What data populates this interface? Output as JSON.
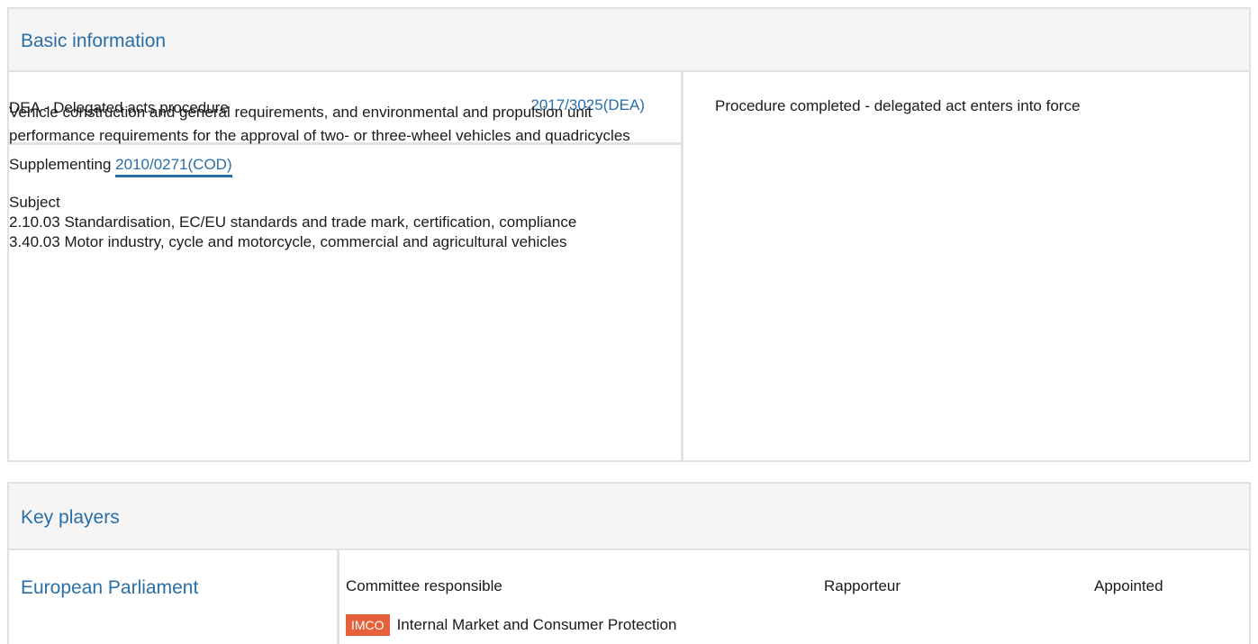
{
  "basic_info": {
    "title": "Basic information",
    "procedure_type": "DEA - Delegated acts procedure",
    "procedure_ref": "2017/3025(DEA)",
    "status": "Procedure completed - delegated act enters into force",
    "description": "Vehicle construction and general requirements, and environmental and propulsion unit performance requirements for the approval of two- or three-wheel vehicles and quadricycles",
    "supplementing_label": "Supplementing",
    "supplementing_ref": "2010/0271(COD)",
    "subject_heading": "Subject",
    "subjects": [
      "2.10.03 Standardisation, EC/EU standards and trade mark, certification, compliance",
      "3.40.03 Motor industry, cycle and motorcycle, commercial and agricultural vehicles"
    ]
  },
  "key_players": {
    "title": "Key players",
    "institution": "European Parliament",
    "columns": {
      "committee": "Committee responsible",
      "rapporteur": "Rapporteur",
      "appointed": "Appointed"
    },
    "committee_badge": "IMCO",
    "committee_badge_color": "#e8603a",
    "committee_name": "Internal Market and Consumer Protection"
  },
  "colors": {
    "link": "#2a6ea8",
    "border": "#e1e1e1",
    "header_bg": "#f5f5f5"
  }
}
